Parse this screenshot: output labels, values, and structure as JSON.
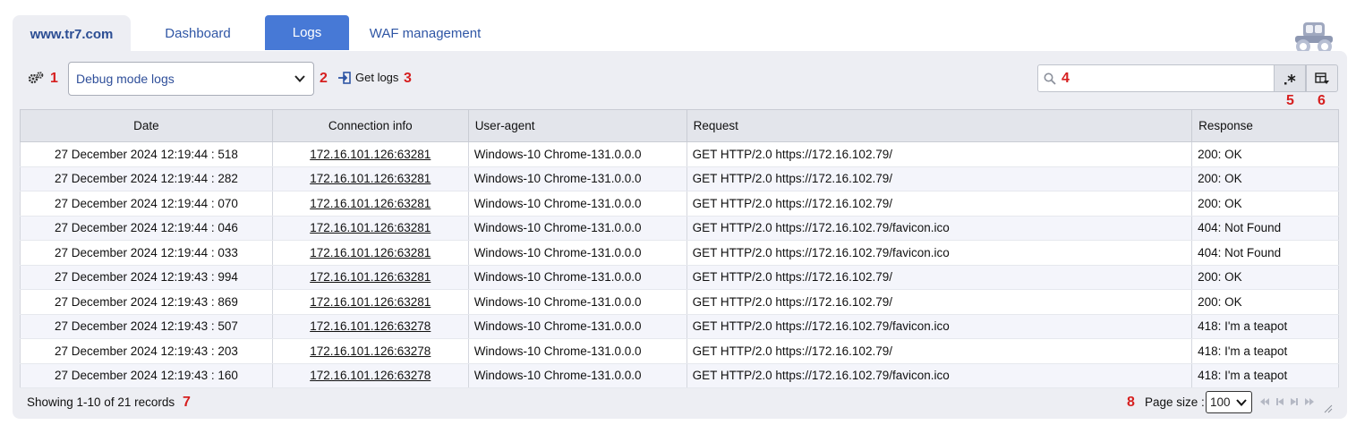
{
  "tabs": {
    "site": "www.tr7.com",
    "dashboard": "Dashboard",
    "logs": "Logs",
    "waf": "WAF management"
  },
  "markers": [
    "1",
    "2",
    "3",
    "4",
    "5",
    "6",
    "7",
    "8"
  ],
  "toolbar": {
    "log_type_selected": "Debug mode logs",
    "get_logs_label": "Get logs",
    "search_value": ""
  },
  "table": {
    "headers": [
      "Date",
      "Connection info",
      "User-agent",
      "Request",
      "Response"
    ],
    "rows": [
      [
        "27 December 2024 12:19:44 : 518",
        "172.16.101.126:63281",
        "Windows-10 Chrome-131.0.0.0",
        "GET HTTP/2.0 https://172.16.102.79/",
        "200: OK"
      ],
      [
        "27 December 2024 12:19:44 : 282",
        "172.16.101.126:63281",
        "Windows-10 Chrome-131.0.0.0",
        "GET HTTP/2.0 https://172.16.102.79/",
        "200: OK"
      ],
      [
        "27 December 2024 12:19:44 : 070",
        "172.16.101.126:63281",
        "Windows-10 Chrome-131.0.0.0",
        "GET HTTP/2.0 https://172.16.102.79/",
        "200: OK"
      ],
      [
        "27 December 2024 12:19:44 : 046",
        "172.16.101.126:63281",
        "Windows-10 Chrome-131.0.0.0",
        "GET HTTP/2.0 https://172.16.102.79/favicon.ico",
        "404: Not Found"
      ],
      [
        "27 December 2024 12:19:44 : 033",
        "172.16.101.126:63281",
        "Windows-10 Chrome-131.0.0.0",
        "GET HTTP/2.0 https://172.16.102.79/favicon.ico",
        "404: Not Found"
      ],
      [
        "27 December 2024 12:19:43 : 994",
        "172.16.101.126:63281",
        "Windows-10 Chrome-131.0.0.0",
        "GET HTTP/2.0 https://172.16.102.79/",
        "200: OK"
      ],
      [
        "27 December 2024 12:19:43 : 869",
        "172.16.101.126:63281",
        "Windows-10 Chrome-131.0.0.0",
        "GET HTTP/2.0 https://172.16.102.79/",
        "200: OK"
      ],
      [
        "27 December 2024 12:19:43 : 507",
        "172.16.101.126:63278",
        "Windows-10 Chrome-131.0.0.0",
        "GET HTTP/2.0 https://172.16.102.79/favicon.ico",
        "418: I'm a teapot"
      ],
      [
        "27 December 2024 12:19:43 : 203",
        "172.16.101.126:63278",
        "Windows-10 Chrome-131.0.0.0",
        "GET HTTP/2.0 https://172.16.102.79/",
        "418: I'm a teapot"
      ],
      [
        "27 December 2024 12:19:43 : 160",
        "172.16.101.126:63278",
        "Windows-10 Chrome-131.0.0.0",
        "GET HTTP/2.0 https://172.16.102.79/favicon.ico",
        "418: I'm a teapot"
      ]
    ]
  },
  "footer": {
    "records_text": "Showing 1-10 of 21 records",
    "page_size_label": "Page size :",
    "page_size_value": "100"
  },
  "icons": {
    "settings": "gears-icon",
    "get_logs": "sign-in-icon",
    "search": "search-icon",
    "regex": "regex-icon",
    "columns": "column-select-icon",
    "logo": "tractor-logo-icon"
  },
  "colors": {
    "accent": "#4779d6",
    "panel": "#edeef3",
    "marker": "#d61f1f",
    "link": "#2f56a5"
  }
}
